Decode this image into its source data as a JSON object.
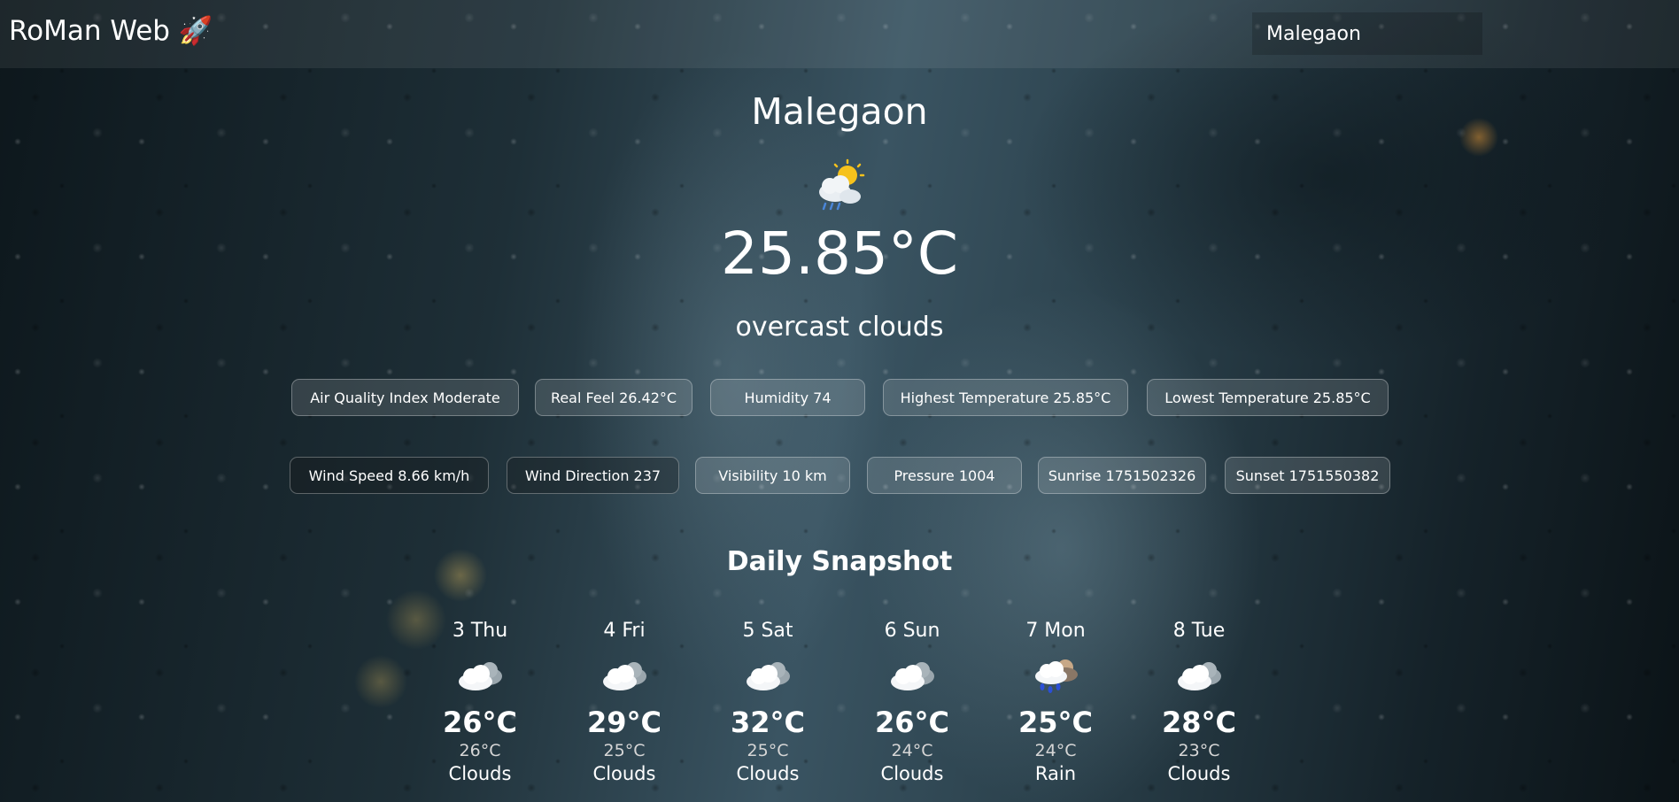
{
  "header": {
    "brand": "RoMan Web 🚀",
    "search_value": "Malegaon"
  },
  "current": {
    "city": "Malegaon",
    "icon": "partly-cloudy-rain-icon",
    "temperature": "25.85°C",
    "description": "overcast clouds"
  },
  "stats_row1": [
    {
      "label": "Air Quality Index Moderate"
    },
    {
      "label": "Real Feel 26.42°C"
    },
    {
      "label": "Humidity 74"
    },
    {
      "label": "Highest Temperature 25.85°C"
    },
    {
      "label": "Lowest Temperature 25.85°C"
    }
  ],
  "stats_row2": [
    {
      "label": "Wind Speed 8.66 km/h"
    },
    {
      "label": "Wind Direction 237"
    },
    {
      "label": "Visibility 10 km"
    },
    {
      "label": "Pressure 1004"
    },
    {
      "label": "Sunrise 1751502326"
    },
    {
      "label": "Sunset 1751550382"
    }
  ],
  "daily": {
    "title": "Daily Snapshot",
    "days": [
      {
        "day": "3 Thu",
        "high": "26°C",
        "low": "26°C",
        "condition": "Clouds",
        "icon": "cloud-icon"
      },
      {
        "day": "4 Fri",
        "high": "29°C",
        "low": "25°C",
        "condition": "Clouds",
        "icon": "cloud-icon"
      },
      {
        "day": "5 Sat",
        "high": "32°C",
        "low": "25°C",
        "condition": "Clouds",
        "icon": "cloud-icon"
      },
      {
        "day": "6 Sun",
        "high": "26°C",
        "low": "24°C",
        "condition": "Clouds",
        "icon": "cloud-icon"
      },
      {
        "day": "7 Mon",
        "high": "25°C",
        "low": "24°C",
        "condition": "Rain",
        "icon": "rain-cloud-icon"
      },
      {
        "day": "8 Tue",
        "high": "28°C",
        "low": "23°C",
        "condition": "Clouds",
        "icon": "cloud-icon"
      }
    ]
  }
}
